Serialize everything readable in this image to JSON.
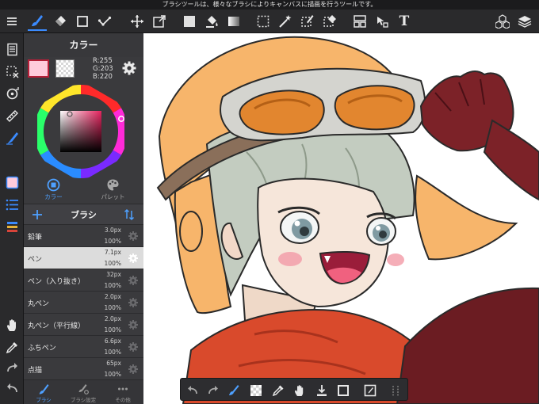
{
  "status": {
    "message": "ブラシツールは、様々なブラシによりキャンバスに描画を行うツールです。"
  },
  "toolbar": {
    "text_tool_glyph": "T",
    "items": [
      "menu-icon",
      "brush-icon",
      "eraser-icon",
      "rectangle-icon",
      "polyline-icon",
      "move-icon",
      "transform-icon",
      "fill-color-icon",
      "bucket-icon",
      "gradient-icon",
      "select-rect-icon",
      "magic-wand-icon",
      "select-pen-icon",
      "select-eraser-icon",
      "frame-icon",
      "operation-icon",
      "text-icon",
      "material-icon",
      "layers-icon"
    ]
  },
  "color_panel": {
    "title": "カラー",
    "main_color": "#ffcbdc",
    "r_label": "R:255",
    "g_label": "G:203",
    "b_label": "B:220",
    "tabs": [
      {
        "label": "カラー",
        "icon": "color-ring-icon",
        "active": true
      },
      {
        "label": "パレット",
        "icon": "palette-icon",
        "active": false
      }
    ]
  },
  "brush_panel": {
    "title": "ブラシ",
    "brushes": [
      {
        "name": "鉛筆",
        "size": "3.0px",
        "opacity": "100%",
        "selected": false
      },
      {
        "name": "ペン",
        "size": "7.1px",
        "opacity": "100%",
        "selected": true
      },
      {
        "name": "ペン（入り抜き）",
        "size": "32px",
        "opacity": "100%",
        "selected": false
      },
      {
        "name": "丸ペン",
        "size": "2.0px",
        "opacity": "100%",
        "selected": false
      },
      {
        "name": "丸ペン（平行線）",
        "size": "2.0px",
        "opacity": "100%",
        "selected": false
      },
      {
        "name": "ふちペン",
        "size": "6.6px",
        "opacity": "100%",
        "selected": false
      },
      {
        "name": "点描",
        "size": "65px",
        "opacity": "100%",
        "selected": false
      }
    ],
    "bottom_tabs": [
      {
        "label": "ブラシ",
        "icon": "brush-icon",
        "active": true
      },
      {
        "label": "ブラシ設定",
        "icon": "brush-settings-icon",
        "active": false
      },
      {
        "label": "その他",
        "icon": "more-icon",
        "active": false
      }
    ]
  },
  "colors": {
    "accent": "#3b8bff",
    "selected_outline": "#b51f38",
    "panel_bg": "#3a3a3d",
    "toolbar_bg": "#2a2a2c"
  }
}
